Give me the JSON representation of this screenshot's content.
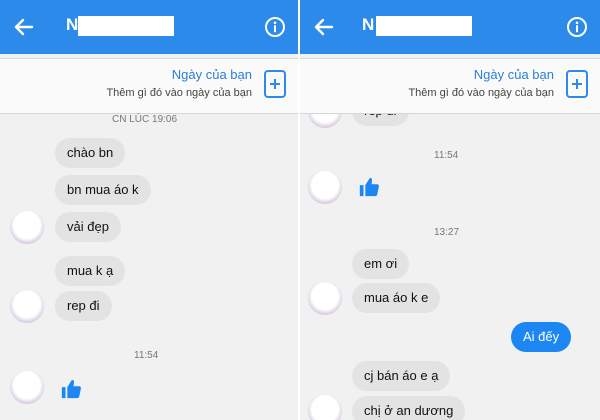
{
  "left": {
    "header": {
      "contact_name": "N"
    },
    "banner": {
      "title": "Ngày của bạn",
      "subtitle": "Thêm gì đó vào ngày của bạn"
    },
    "top_timestamp": "CN LÚC 19:06",
    "messages": [
      "chào bn",
      "bn mua áo k",
      "vải đẹp",
      "mua k ạ",
      "rep đi"
    ],
    "timestamp": "11:54"
  },
  "right": {
    "header": {
      "contact_name": "N"
    },
    "banner": {
      "title": "Ngày của bạn",
      "subtitle": "Thêm gì đó vào ngày của bạn"
    },
    "messages_top": [
      "rep đi"
    ],
    "timestamp_1": "11:54",
    "timestamp_2": "13:27",
    "messages_mid": [
      "em ơi",
      "mua áo k e"
    ],
    "outgoing": "Ai đếy",
    "messages_bottom": [
      "cj bán áo e ạ",
      "chị ở an dương"
    ]
  },
  "colors": {
    "header": "#2c8bea",
    "outgoing_bubble": "#1c86f2",
    "incoming_bubble": "#e3e3e3",
    "background": "#f1f1f1"
  },
  "icons": [
    "back-arrow-icon",
    "info-icon",
    "add-icon",
    "thumbs-up-icon"
  ]
}
